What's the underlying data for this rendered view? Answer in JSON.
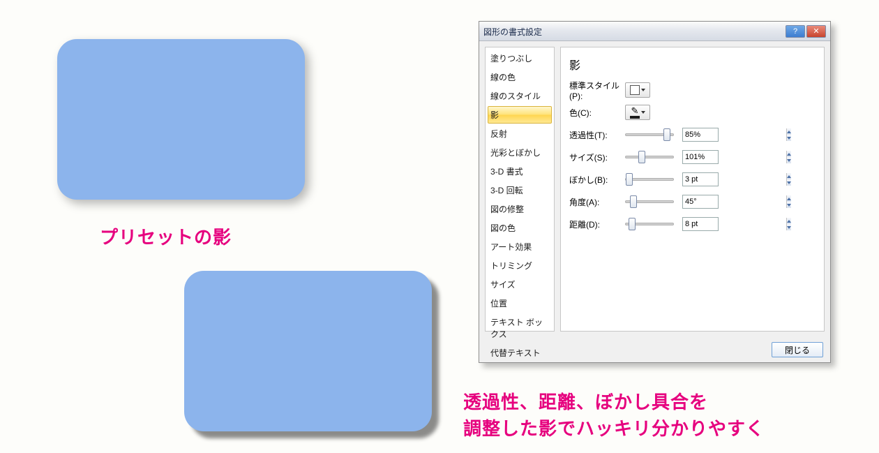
{
  "shapes": {
    "preset_caption": "プリセットの影",
    "custom_caption_line1": "透過性、距離、ぼかし具合を",
    "custom_caption_line2": "調整した影でハッキリ分かりやすく"
  },
  "dialog": {
    "title": "図形の書式設定",
    "help_label": "?",
    "close_label": "✕",
    "sidebar": {
      "items": [
        "塗りつぶし",
        "線の色",
        "線のスタイル",
        "影",
        "反射",
        "光彩とぼかし",
        "3-D 書式",
        "3-D 回転",
        "図の修整",
        "図の色",
        "アート効果",
        "トリミング",
        "サイズ",
        "位置",
        "テキスト ボックス",
        "代替テキスト"
      ],
      "selected_index": 3
    },
    "pane": {
      "heading": "影",
      "preset_label": "標準スタイル(P):",
      "color_label": "色(C):",
      "transparency_label": "透過性(T):",
      "size_label": "サイズ(S):",
      "blur_label": "ぼかし(B):",
      "angle_label": "角度(A):",
      "distance_label": "距離(D):",
      "values": {
        "transparency": "85%",
        "size": "101%",
        "blur": "3 pt",
        "angle": "45°",
        "distance": "8 pt"
      },
      "slider_pos": {
        "transparency": 54,
        "size": 18,
        "blur": 0,
        "angle": 6,
        "distance": 4
      }
    },
    "footer": {
      "close": "閉じる"
    }
  }
}
